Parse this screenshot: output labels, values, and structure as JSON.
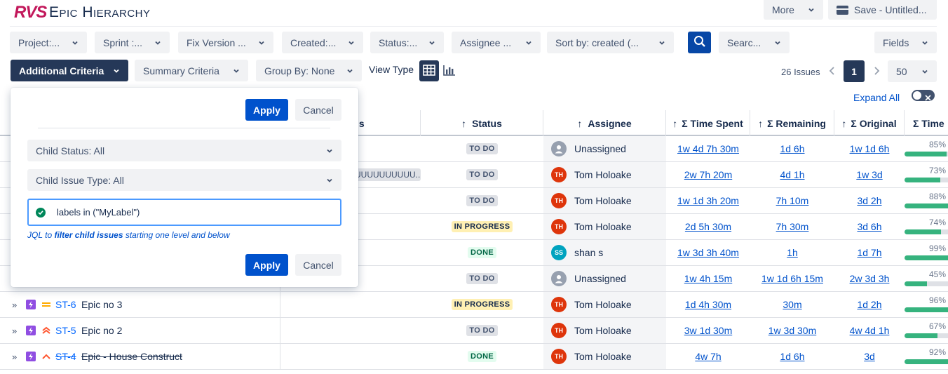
{
  "app": {
    "logo": "RVS",
    "title": "Epic Hierarchy"
  },
  "header": {
    "more_label": "More",
    "save_label": "Save - Untitled..."
  },
  "filters": [
    {
      "label": "Project:..."
    },
    {
      "label": "Sprint :..."
    },
    {
      "label": "Fix Version ..."
    },
    {
      "label": "Created:..."
    },
    {
      "label": "Status:..."
    },
    {
      "label": "Assignee ..."
    },
    {
      "label": "Sort by: created (..."
    }
  ],
  "search": {
    "label": "Searc..."
  },
  "fields_label": "Fields",
  "row2": {
    "additional_criteria": "Additional Criteria",
    "summary_criteria": "Summary Criteria",
    "group_by": "Group By: None",
    "view_type": "View Type"
  },
  "pagination": {
    "issues_count": "26 Issues",
    "current_page": "1",
    "page_size": "50"
  },
  "expand_all": "Expand All",
  "popup": {
    "apply": "Apply",
    "cancel": "Cancel",
    "child_status": "Child Status: All",
    "child_issue_type": "Child Issue Type: All",
    "jql_value": "labels in (\"MyLabel\")",
    "hint_prefix": "JQL to ",
    "hint_bold": "filter child issues",
    "hint_suffix": " starting one level and below"
  },
  "columns": {
    "details_partial": "ls",
    "status": "Status",
    "assignee": "Assignee",
    "time_spent": "Σ Time Spent",
    "remaining": "Σ Remaining",
    "original": "Σ Original",
    "time_progress": "Σ Time"
  },
  "sort_arrow": "↑",
  "rows": [
    {
      "status": "TO DO",
      "status_kind": "todo",
      "assignee": "Unassigned",
      "initials": "",
      "avatar": "none",
      "spent": "1w 4d 7h 30m",
      "remaining": "1d 6h",
      "original": "1w 1d 6h",
      "progress": "85%",
      "fraction": 0.85
    },
    {
      "detail": "UUUUUUUUUU...",
      "status": "TO DO",
      "status_kind": "todo",
      "assignee": "Tom Holoake",
      "initials": "TH",
      "avatar": "#de350b",
      "spent": "2w 7h 20m",
      "remaining": "4d 1h",
      "original": "1w 3d",
      "progress": "73%",
      "fraction": 0.73
    },
    {
      "status": "TO DO",
      "status_kind": "todo",
      "assignee": "Tom Holoake",
      "initials": "TH",
      "avatar": "#de350b",
      "spent": "1w 1d 3h 20m",
      "remaining": "7h 10m",
      "original": "3d 2h",
      "progress": "88%",
      "fraction": 0.88
    },
    {
      "status": "IN PROGRESS",
      "status_kind": "inprog",
      "assignee": "Tom Holoake",
      "initials": "TH",
      "avatar": "#de350b",
      "spent": "2d 5h 30m",
      "remaining": "7h 30m",
      "original": "3d 6h",
      "progress": "74%",
      "fraction": 0.74
    },
    {
      "status": "DONE",
      "status_kind": "done",
      "assignee": "shan s",
      "initials": "SS",
      "avatar": "#00a3bf",
      "spent": "1w 3d 3h 40m",
      "remaining": "1h",
      "original": "1d 7h",
      "progress": "99%",
      "fraction": 0.99
    },
    {
      "status": "TO DO",
      "status_kind": "todo",
      "assignee": "Unassigned",
      "initials": "",
      "avatar": "none",
      "spent": "1w 4h 15m",
      "remaining": "1w 1d 6h 15m",
      "original": "2w 3d 3h",
      "progress": "45%",
      "fraction": 0.45
    },
    {
      "key": "ST-6",
      "summary": "Epic no 3",
      "priority": "medium",
      "status": "IN PROGRESS",
      "status_kind": "inprog",
      "assignee": "Tom Holoake",
      "initials": "TH",
      "avatar": "#de350b",
      "spent": "1d 4h 30m",
      "remaining": "30m",
      "original": "1d 2h",
      "progress": "96%",
      "fraction": 0.96
    },
    {
      "key": "ST-5",
      "summary": "Epic no 2",
      "priority": "highest",
      "status": "TO DO",
      "status_kind": "todo",
      "assignee": "Tom Holoake",
      "initials": "TH",
      "avatar": "#de350b",
      "spent": "3w 1d 30m",
      "remaining": "1w 3d 30m",
      "original": "4w 4d 1h",
      "progress": "67%",
      "fraction": 0.67
    },
    {
      "key": "ST-4",
      "summary": "Epic - House Construct",
      "priority": "high",
      "strike": true,
      "status": "DONE",
      "status_kind": "done",
      "assignee": "Tom Holoake",
      "initials": "TH",
      "avatar": "#de350b",
      "spent": "4w 7h",
      "remaining": "1d 6h",
      "original": "3d",
      "progress": "92%",
      "fraction": 0.92
    }
  ],
  "colors": {
    "brand": "#0052cc",
    "dark_button": "#253858",
    "progress_green": "#36b37e",
    "logo_magenta": "#c2185b"
  }
}
